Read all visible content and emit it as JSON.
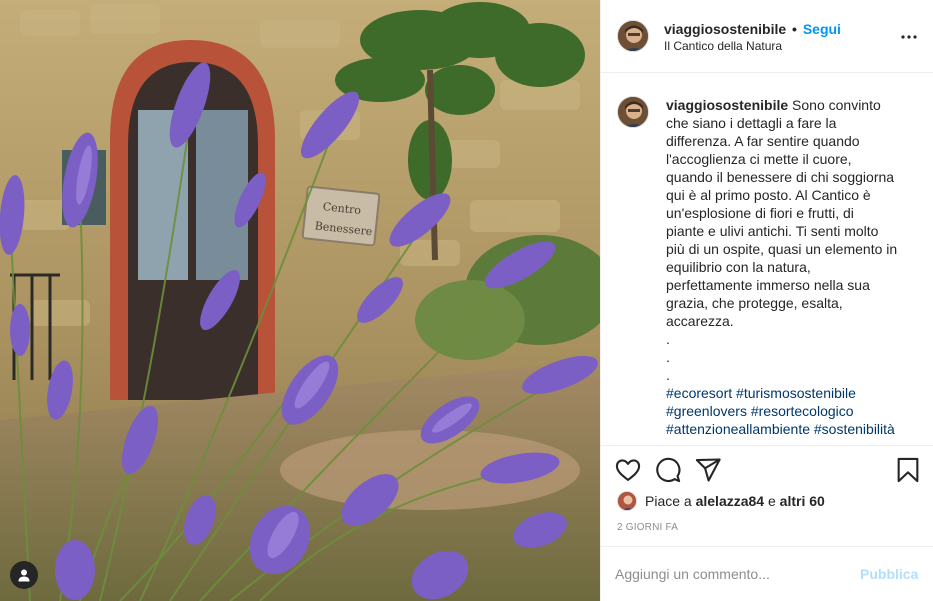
{
  "post": {
    "username": "viaggiosostenibile",
    "separator": "•",
    "follow_label": "Segui",
    "location": "Il Cantico della Natura",
    "photo_sign": [
      "Centro",
      "Benessere"
    ]
  },
  "caption": {
    "username": "viaggiosostenibile",
    "lines": [
      "Sono convinto",
      "che siano i dettagli a fare la",
      "differenza. A far sentire quando",
      "l'accoglienza ci mette il cuore,",
      "quando il benessere di chi soggiorna",
      "qui è al primo posto. Al Cantico è",
      "un'esplosione di fiori e frutti, di",
      "piante e ulivi antichi. Ti senti molto",
      "più di un ospite, quasi un elemento in",
      "equilibrio con la natura,",
      "perfettamente immerso nella sua",
      "grazia, che protegge, esalta,",
      "accarezza.",
      ".",
      ".",
      "."
    ],
    "hashtags": [
      [
        "#ecoresort",
        "#turismosostenibile"
      ],
      [
        "#greenlovers",
        "#resortecologico"
      ],
      [
        "#attenzioneallambiente",
        "#sostenibilità"
      ]
    ]
  },
  "likes": {
    "prefix": "Piace a",
    "user": "alelazza84",
    "middle": "e",
    "others": "altri 60"
  },
  "timestamp": "2 GIORNI FA",
  "comment": {
    "placeholder": "Aggiungi un commento...",
    "publish_label": "Pubblica"
  },
  "colors": {
    "link_blue": "#0095f6",
    "hashtag_blue": "#00376b",
    "publish_disabled": "#b2dffc",
    "secondary_text": "#8e8e8e",
    "lavender": "#7b5fc4"
  },
  "icons": {
    "more": "more-icon",
    "like": "heart-icon",
    "comment": "comment-icon",
    "share": "share-icon",
    "save": "bookmark-icon",
    "tag": "user-tag-icon"
  }
}
